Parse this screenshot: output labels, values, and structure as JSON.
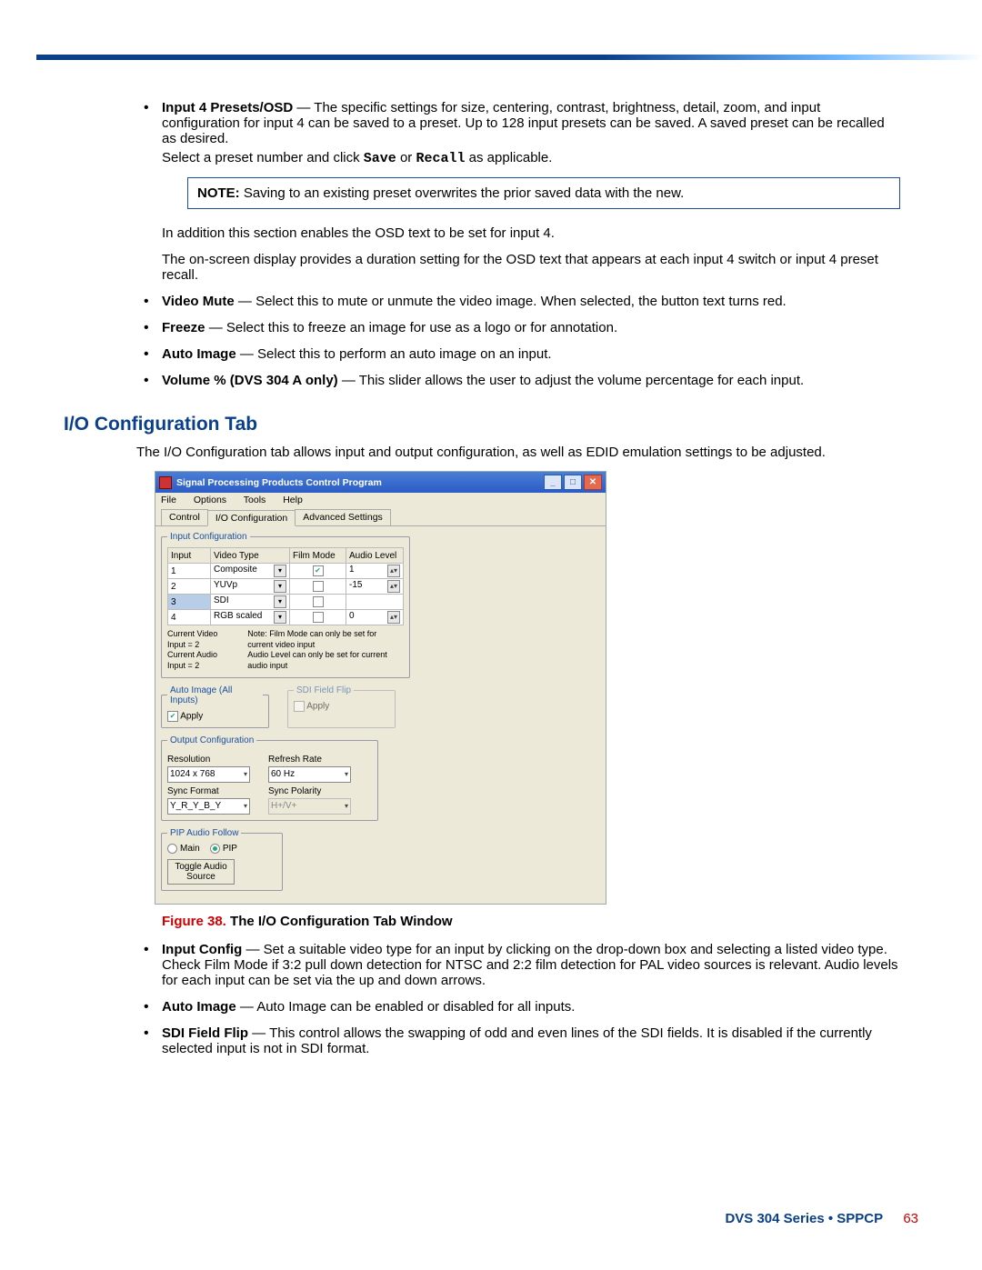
{
  "bullets_top": [
    {
      "label": "Input 4 Presets/OSD",
      "text": " — The specific settings for size, centering, contrast, brightness, detail, zoom, and input configuration for input 4 can be saved to a preset. Up to 128 input presets can be saved. A saved preset can be recalled as desired."
    },
    {
      "label": "Video Mute",
      "text": " — Select this to mute or unmute the video image. When selected, the button text turns red."
    },
    {
      "label": "Freeze",
      "text": " — Select this to freeze an image for use as a logo or for annotation."
    },
    {
      "label": "Auto Image",
      "text": " — Select this to perform an auto image on an input."
    },
    {
      "label": "Volume % (DVS 304 A only)",
      "text": " — This slider allows the user to adjust the volume percentage for each input."
    }
  ],
  "preset_line_prefix": "Select a preset number and click ",
  "preset_save": "Save",
  "preset_or": " or ",
  "preset_recall": "Recall",
  "preset_suffix": " as applicable.",
  "note_label": "NOTE:",
  "note_text": "  Saving to an existing preset overwrites the prior saved data with the new.",
  "osd_para1": "In addition this section enables the OSD text to be set for input 4.",
  "osd_para2": "The on-screen display provides a duration setting for the OSD text that appears at each input 4 switch or input 4 preset recall.",
  "section_heading": "I/O Configuration Tab",
  "section_intro": "The I/O Configuration tab allows input and output configuration, as well as EDID emulation settings to be adjusted.",
  "window": {
    "title": "Signal Processing Products Control Program",
    "menus": [
      "File",
      "Options",
      "Tools",
      "Help"
    ],
    "tabs": [
      "Control",
      "I/O Configuration",
      "Advanced Settings"
    ],
    "input_cfg_legend": "Input Configuration",
    "headers": [
      "Input",
      "Video Type",
      "Film Mode",
      "Audio Level"
    ],
    "rows": [
      {
        "input": "1",
        "type": "Composite",
        "film": true,
        "audio": "1"
      },
      {
        "input": "2",
        "type": "YUVp",
        "film": false,
        "audio": "-15"
      },
      {
        "input": "3",
        "type": "SDI",
        "film": false,
        "audio": "",
        "selected": true
      },
      {
        "input": "4",
        "type": "RGB scaled",
        "film": false,
        "audio": "0"
      }
    ],
    "current_video": "Current Video Input = 2",
    "current_audio": "Current Audio Input = 2",
    "note_film": "Note: Film Mode can only be set for current video input",
    "note_audio": "Audio Level can only be set for current audio input",
    "auto_image_legend": "Auto Image (All Inputs)",
    "apply": "Apply",
    "sdi_flip_legend": "SDI Field Flip",
    "output_cfg_legend": "Output Configuration",
    "resolution_label": "Resolution",
    "resolution": "1024 x 768",
    "refresh_label": "Refresh Rate",
    "refresh": "60 Hz",
    "sync_format_label": "Sync Format",
    "sync_format": "Y_R_Y_B_Y",
    "sync_polarity_label": "Sync Polarity",
    "sync_polarity": "H+/V+",
    "pip_legend": "PIP Audio Follow",
    "main": "Main",
    "pip": "PIP",
    "toggle": "Toggle Audio\nSource"
  },
  "figure_label": "Figure 38. ",
  "figure_text": "The I/O Configuration Tab Window",
  "bullets_bottom": [
    {
      "label": "Input Config",
      "text": " — Set a suitable video type for an input by clicking on the drop-down box and selecting a listed video type. Check Film Mode if 3:2 pull down detection for NTSC and 2:2 film detection for PAL video sources is relevant. Audio levels for each input can be set via the up and down arrows."
    },
    {
      "label": "Auto Image",
      "text": " — Auto Image can be enabled or disabled for all inputs."
    },
    {
      "label": "SDI Field Flip",
      "text": " — This control allows the swapping of odd and even lines of the SDI fields. It is disabled if the currently selected input is not in SDI format."
    }
  ],
  "footer_label": "DVS 304 Series • SPPCP",
  "footer_page": "63"
}
